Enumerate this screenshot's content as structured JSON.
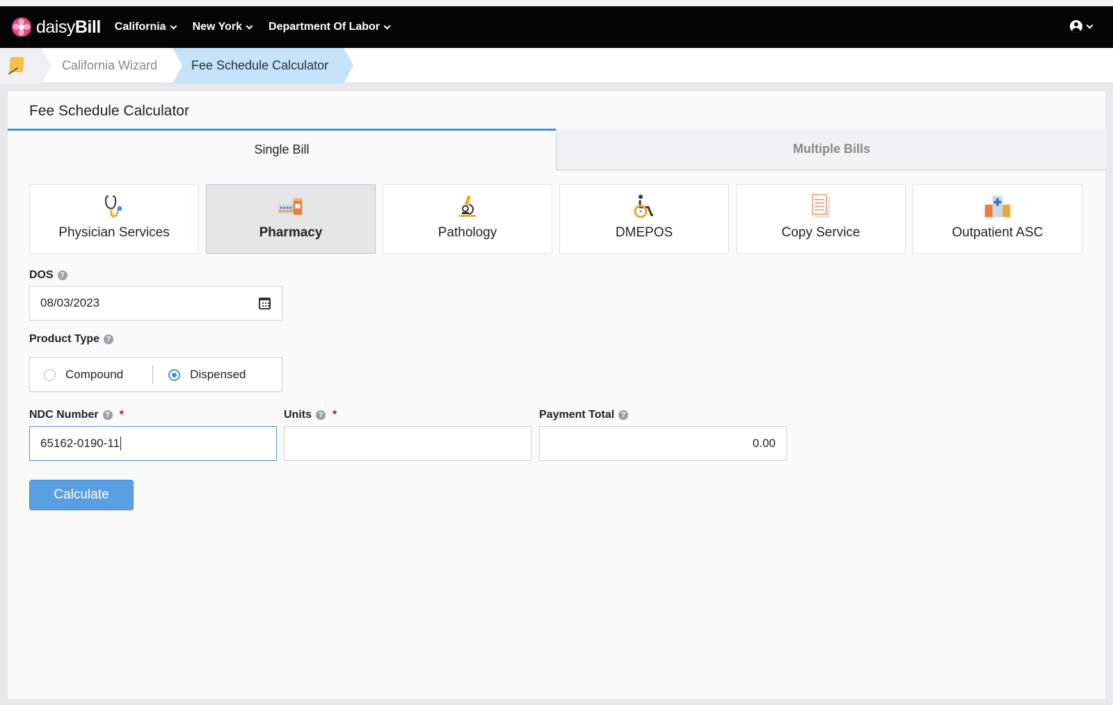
{
  "brand": {
    "name_light": "daisy",
    "name_bold": "Bill"
  },
  "nav": {
    "items": [
      {
        "label": "California"
      },
      {
        "label": "New York"
      },
      {
        "label": "Department Of Labor"
      }
    ]
  },
  "breadcrumb": {
    "items": [
      {
        "label": "California Wizard"
      },
      {
        "label": "Fee Schedule Calculator"
      }
    ]
  },
  "page": {
    "title": "Fee Schedule Calculator"
  },
  "tabs": [
    {
      "label": "Single Bill",
      "active": true
    },
    {
      "label": "Multiple Bills",
      "active": false
    }
  ],
  "categories": [
    {
      "label": "Physician Services",
      "icon": "stethoscope-icon"
    },
    {
      "label": "Pharmacy",
      "icon": "pharmacy-icon",
      "active": true
    },
    {
      "label": "Pathology",
      "icon": "microscope-icon"
    },
    {
      "label": "DMEPOS",
      "icon": "wheelchair-icon"
    },
    {
      "label": "Copy Service",
      "icon": "document-icon"
    },
    {
      "label": "Outpatient ASC",
      "icon": "hospital-icon"
    }
  ],
  "form": {
    "dos": {
      "label": "DOS",
      "value": "08/03/2023"
    },
    "product_type": {
      "label": "Product Type",
      "options": [
        "Compound",
        "Dispensed"
      ],
      "selected": "Dispensed"
    },
    "ndc": {
      "label": "NDC Number",
      "required_mark": "*",
      "value": "65162-0190-11"
    },
    "units": {
      "label": "Units",
      "required_mark": "*",
      "value": ""
    },
    "payment_total": {
      "label": "Payment Total",
      "value": "0.00"
    },
    "calculate_label": "Calculate"
  },
  "colors": {
    "accent": "#4a90d9",
    "button": "#5a9fe2",
    "navbar": "#050505",
    "crumb_active": "#c7e3fb",
    "brand_pink": "#e8408a"
  }
}
